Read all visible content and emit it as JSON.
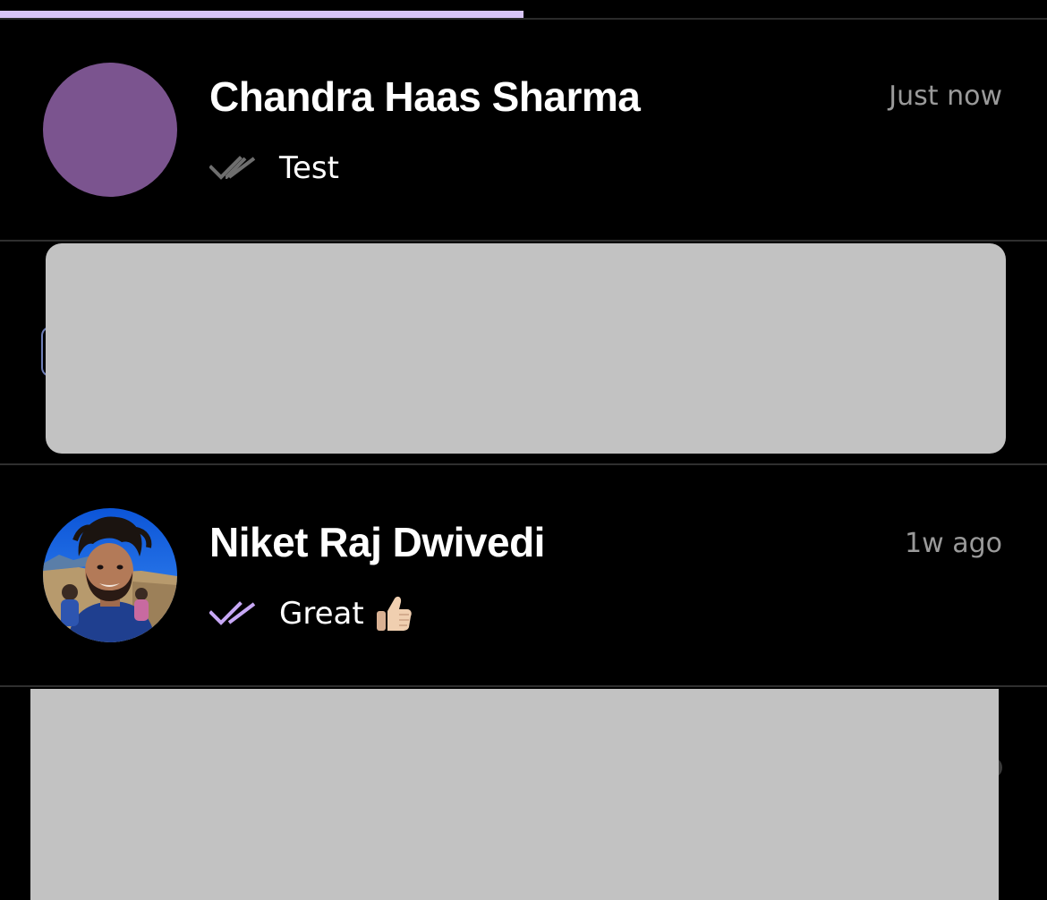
{
  "progress": {
    "fraction": 0.5,
    "color": "#d7c4f5"
  },
  "conversations": [
    {
      "name": "Chandra Haas Sharma",
      "time": "Just now",
      "last_message": "Test",
      "read_status": "delivered",
      "check_color": "#6e6e6e",
      "avatar_color": "#7b548f",
      "avatar_type": "solid"
    },
    {
      "redacted": true
    },
    {
      "name": "Niket Raj Dwivedi",
      "time": "1w ago",
      "last_message": "Great",
      "read_status": "read",
      "check_color": "#c7a8f5",
      "avatar_type": "photo",
      "emoji_icon": "thumbs-up-icon"
    },
    {
      "redacted": true
    }
  ],
  "colors": {
    "background": "#000000",
    "divider": "#2f2f2f",
    "redaction": "#c2c2c2",
    "timestamp": "#9a9a9a"
  }
}
